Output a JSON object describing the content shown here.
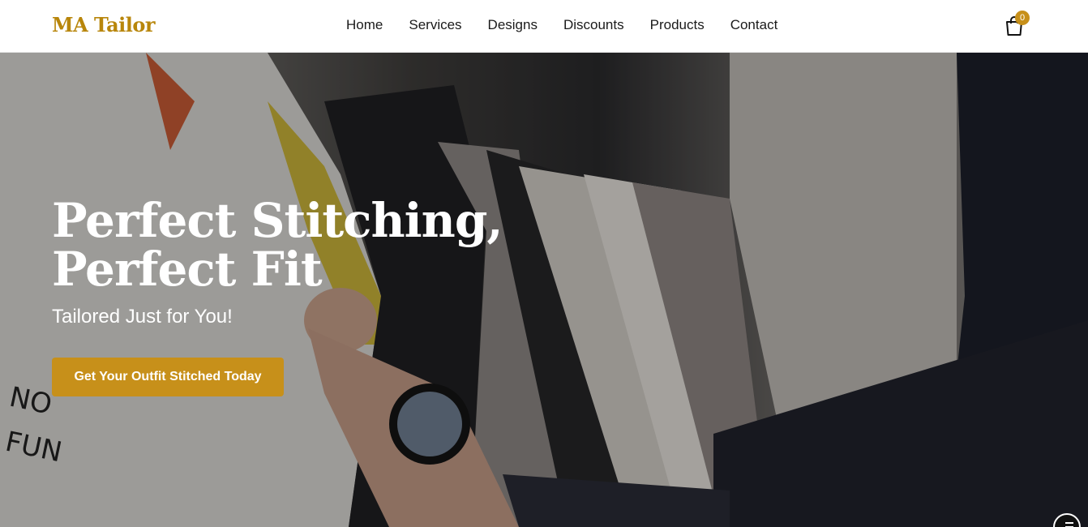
{
  "brand": {
    "name": "MA Tailor",
    "color": "#b8860b"
  },
  "nav": {
    "items": [
      {
        "label": "Home"
      },
      {
        "label": "Services"
      },
      {
        "label": "Designs"
      },
      {
        "label": "Discounts"
      },
      {
        "label": "Products"
      },
      {
        "label": "Contact"
      }
    ]
  },
  "cart": {
    "count": "0",
    "icon": "shopping-bag-icon"
  },
  "hero": {
    "title_line1": "Perfect Stitching,",
    "title_line2": "Perfect Fit",
    "subtitle": "Tailored Just for You!",
    "cta_label": "Get Your Outfit Stitched Today",
    "accent": "#c7901a"
  },
  "widget": {
    "icon": "accessibility-menu-icon"
  }
}
